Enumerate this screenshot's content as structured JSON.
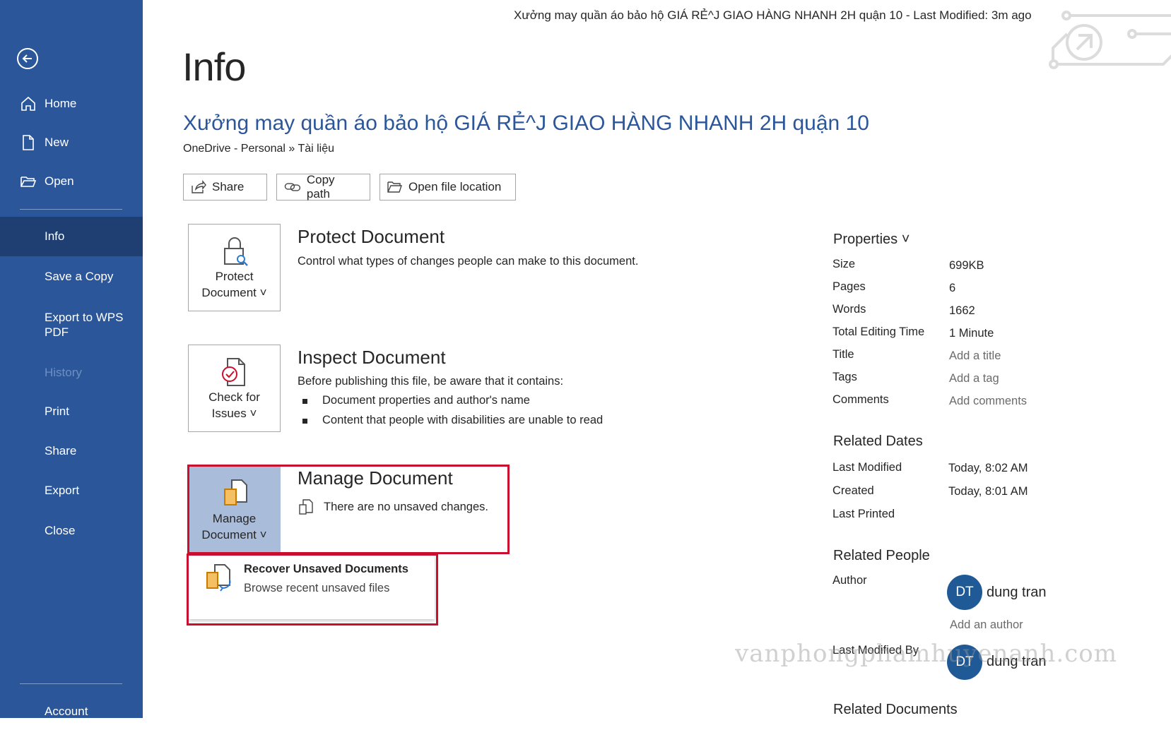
{
  "window": {
    "title_bar": "Xưởng may quần áo bảo hộ GIÁ RẺ^J GIAO HÀNG NHANH 2H quận 10  -  Last Modified: 3m ago"
  },
  "sidebar": {
    "items": [
      {
        "label": "Home",
        "icon": "home-icon"
      },
      {
        "label": "New",
        "icon": "new-document-icon"
      },
      {
        "label": "Open",
        "icon": "folder-open-icon"
      },
      {
        "label": "Info",
        "selected": true
      },
      {
        "label": "Save a Copy"
      },
      {
        "label": "Export to WPS PDF"
      },
      {
        "label": "History",
        "disabled": true
      },
      {
        "label": "Print"
      },
      {
        "label": "Share"
      },
      {
        "label": "Export"
      },
      {
        "label": "Close"
      },
      {
        "label": "Account"
      }
    ]
  },
  "main": {
    "page_title": "Info",
    "doc_title": "Xưởng may quần áo bảo hộ GIÁ RẺ^J GIAO HÀNG NHANH 2H quận 10",
    "breadcrumb": "OneDrive - Personal » Tài liệu",
    "actions": {
      "share": "Share",
      "copy_path": "Copy path",
      "open_location": "Open file location"
    },
    "protect": {
      "button": "Protect Document ⌄",
      "button_l1": "Protect",
      "button_l2": "Document ˅",
      "heading": "Protect Document",
      "desc": "Control what types of changes people can make to this document."
    },
    "inspect": {
      "button_l1": "Check for",
      "button_l2": "Issues ˅",
      "heading": "Inspect Document",
      "desc": "Before publishing this file, be aware that it contains:",
      "bullets": [
        "Document properties and author's name",
        "Content that people with disabilities are unable to read"
      ]
    },
    "manage": {
      "button_l1": "Manage",
      "button_l2": "Document ˅",
      "heading": "Manage Document",
      "desc": "There are no unsaved changes."
    },
    "recover": {
      "title": "Recover Unsaved Documents",
      "subtitle": "Browse recent unsaved files"
    }
  },
  "properties": {
    "heading": "Properties ˅",
    "rows": [
      {
        "key": "Size",
        "value": "699KB"
      },
      {
        "key": "Pages",
        "value": "6"
      },
      {
        "key": "Words",
        "value": "1662"
      },
      {
        "key": "Total Editing Time",
        "value": "1 Minute"
      },
      {
        "key": "Title",
        "value": "Add a title"
      },
      {
        "key": "Tags",
        "value": "Add a tag"
      },
      {
        "key": "Comments",
        "value": "Add comments"
      }
    ],
    "related_dates": {
      "heading": "Related Dates",
      "rows": [
        {
          "key": "Last Modified",
          "value": "Today, 8:02 AM"
        },
        {
          "key": "Created",
          "value": "Today, 8:01 AM"
        },
        {
          "key": "Last Printed",
          "value": ""
        }
      ]
    },
    "related_people": {
      "heading": "Related People",
      "author_key": "Author",
      "author_initials": "DT",
      "author_name": "dung tran",
      "add_author": "Add an author",
      "last_modified_by_key": "Last Modified By",
      "last_modified_by_initials": "DT",
      "last_modified_by_name": "dung tran"
    },
    "related_documents": {
      "heading": "Related Documents"
    }
  },
  "watermark": "vanphongphamhuyenanh.com",
  "colors": {
    "sidebar": "#2b579a",
    "sidebar_selected": "#1f3f73",
    "accent": "#2b579a",
    "highlight": "#c8102e",
    "active_tile": "#a9bcd9"
  }
}
